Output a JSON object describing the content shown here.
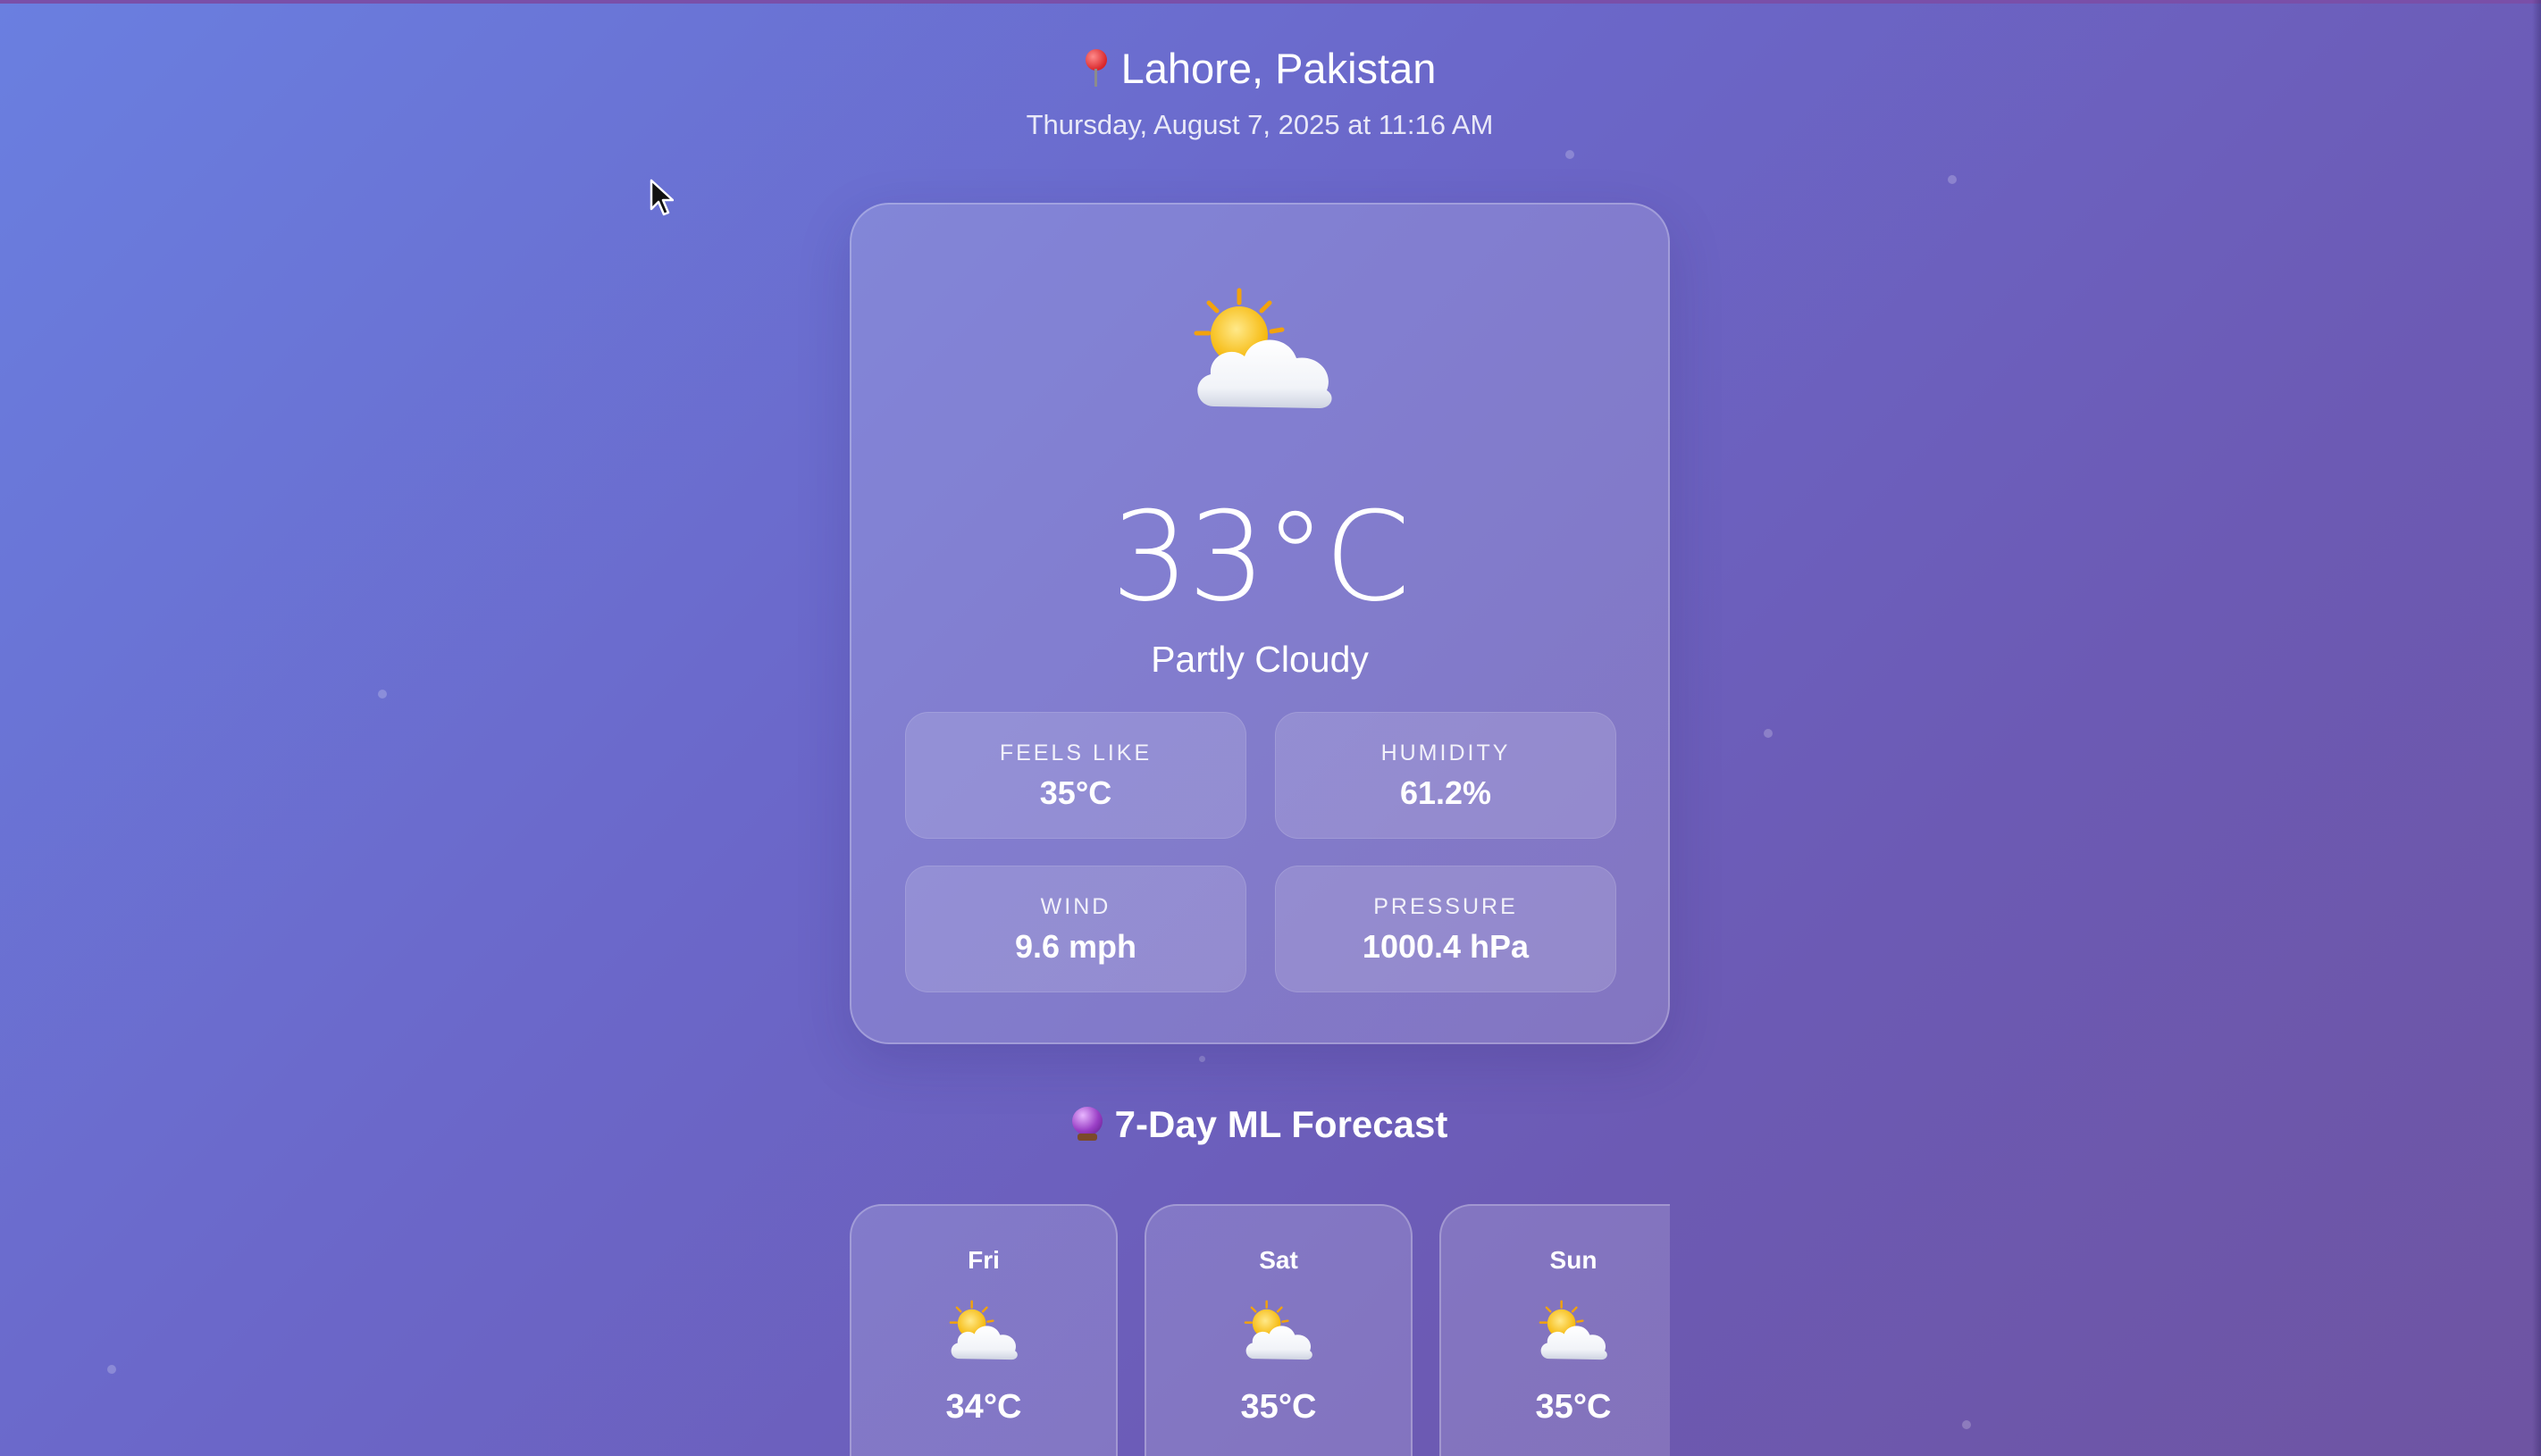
{
  "location": {
    "icon": "map-pin-icon",
    "name": "Lahore, Pakistan"
  },
  "datetime": "Thursday, August 7, 2025 at 11:16 AM",
  "current": {
    "icon": "sun-behind-cloud-icon",
    "temperature": "33°C",
    "condition": "Partly Cloudy",
    "stats": [
      {
        "label": "FEELS LIKE",
        "value": "35°C"
      },
      {
        "label": "HUMIDITY",
        "value": "61.2%"
      },
      {
        "label": "WIND",
        "value": "9.6 mph"
      },
      {
        "label": "PRESSURE",
        "value": "1000.4 hPa"
      }
    ]
  },
  "forecast": {
    "icon": "crystal-ball-icon",
    "title": "7-Day ML Forecast",
    "days": [
      {
        "day": "Fri",
        "icon": "sun-behind-cloud-icon",
        "temp": "34°C"
      },
      {
        "day": "Sat",
        "icon": "sun-behind-cloud-icon",
        "temp": "35°C"
      },
      {
        "day": "Sun",
        "icon": "sun-behind-cloud-icon",
        "temp": "35°C"
      }
    ]
  }
}
